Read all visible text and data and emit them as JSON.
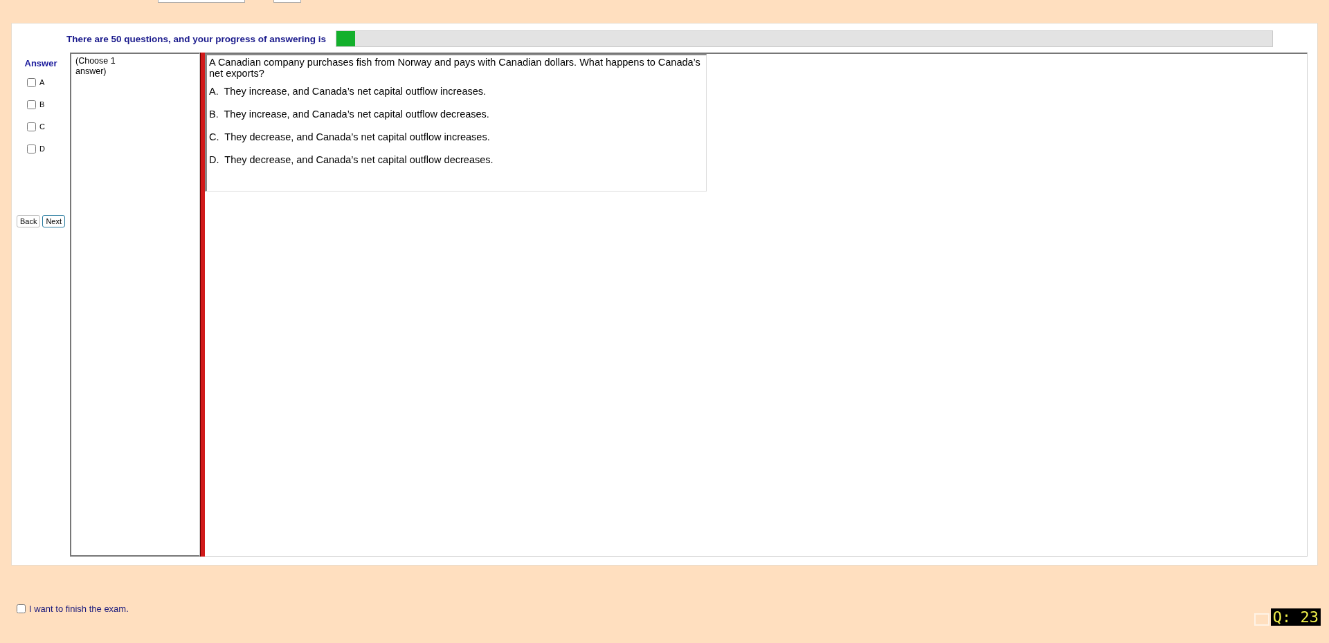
{
  "progress": {
    "label": "There are 50 questions, and your progress of answering is",
    "level": 0.02
  },
  "answer_panel": {
    "title": "Answer",
    "options": [
      {
        "label": "A",
        "checked": false
      },
      {
        "label": "B",
        "checked": false
      },
      {
        "label": "C",
        "checked": false
      },
      {
        "label": "D",
        "checked": false
      }
    ]
  },
  "buttons": [
    {
      "label": "Back",
      "selected": false
    },
    {
      "label": "Next",
      "selected": true
    }
  ],
  "instruction": [
    "(Choose 1",
    "answer)"
  ],
  "question": {
    "text": "A Canadian company purchases fish from Norway and pays with Canadian dollars. What happens to Canada’s net exports?",
    "choices": [
      {
        "letter": "A.",
        "text": "They increase, and Canada’s net capital outflow increases."
      },
      {
        "letter": "B.",
        "text": "They increase, and Canada’s net capital outflow decreases."
      },
      {
        "letter": "C.",
        "text": "They decrease, and Canada’s net capital outflow increases."
      },
      {
        "letter": "D.",
        "text": "They decrease, and Canada’s net capital outflow decreases."
      }
    ]
  },
  "finish": {
    "label": "I want to finish the exam.",
    "checked": false
  },
  "question_counter": "Q: 23"
}
